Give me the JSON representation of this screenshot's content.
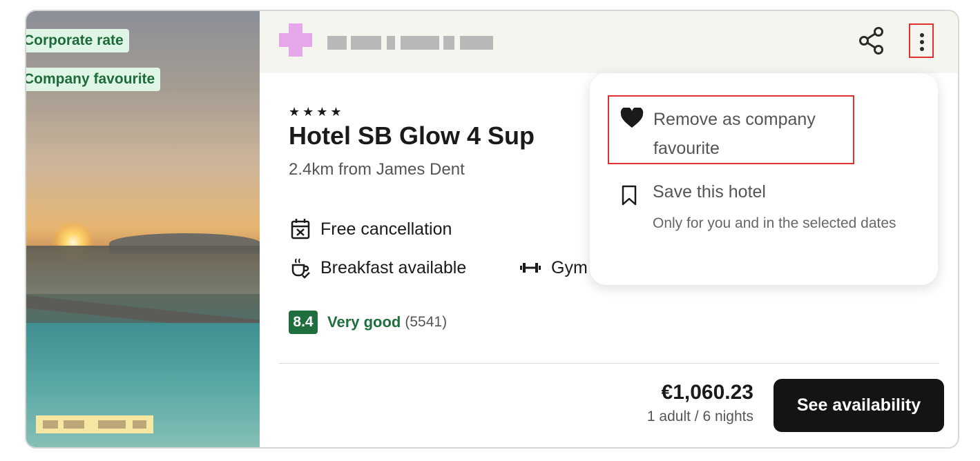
{
  "badges": {
    "corporate_rate": "Corporate rate",
    "company_favourite": "Company favourite"
  },
  "hotel": {
    "stars": "★★★★",
    "name": "Hotel SB Glow 4 Sup",
    "distance": "2.4km from James Dent"
  },
  "features": {
    "free_cancellation": "Free cancellation",
    "breakfast": "Breakfast available",
    "gym": "Gym"
  },
  "rating": {
    "score": "8.4",
    "label": "Very good",
    "count": "(5541)"
  },
  "pricing": {
    "amount": "€1,060.23",
    "details": "1 adult / 6 nights",
    "cta": "See availability"
  },
  "menu": {
    "remove_favourite": "Remove as company favourite",
    "save_hotel": "Save this hotel",
    "save_hotel_sub": "Only for you and in the selected dates"
  },
  "colors": {
    "badge_bg": "#dff5e6",
    "badge_text": "#1e6b3a",
    "score_green": "#1f6e3e",
    "cta_bg": "#141414",
    "highlight_red": "#e03030"
  },
  "icons": [
    "share-icon",
    "more-vertical-icon",
    "calendar-x-icon",
    "breakfast-cup-icon",
    "dumbbell-icon",
    "heart-icon",
    "bookmark-icon"
  ]
}
